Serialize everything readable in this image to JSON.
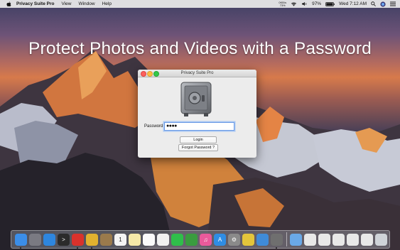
{
  "menubar": {
    "app_name": "Privacy Suite Pro",
    "menus": [
      "View",
      "Window",
      "Help"
    ],
    "status": {
      "net_up": "0KB/s",
      "net_down": "73%",
      "battery": "97%",
      "time": "Wed 7:12 AM"
    },
    "icons": [
      "apple-icon",
      "network-stats-icon",
      "wifi-icon",
      "volume-icon",
      "battery-icon",
      "search-icon",
      "siri-icon",
      "menu-list-icon"
    ]
  },
  "headline": "Protect Photos and Videos with a Password",
  "window": {
    "title": "Privacy Suite Pro",
    "password_label": "Password",
    "password_value": "●●●●",
    "login_label": "Login",
    "forgot_label": "Forgot Password ?"
  },
  "dock": {
    "apps": [
      {
        "name": "finder-icon",
        "color": "#3b8ee8",
        "glyph": ""
      },
      {
        "name": "launchpad-icon",
        "color": "#7a7a82",
        "glyph": ""
      },
      {
        "name": "safari-icon",
        "color": "#2e86de",
        "glyph": ""
      },
      {
        "name": "terminal-icon",
        "color": "#2b2b2b",
        "glyph": ">"
      },
      {
        "name": "opera-icon",
        "color": "#d9322c",
        "glyph": ""
      },
      {
        "name": "chrome-icon",
        "color": "#e0b12f",
        "glyph": ""
      },
      {
        "name": "notefile-icon",
        "color": "#9a7a4c",
        "glyph": ""
      },
      {
        "name": "calendar-icon",
        "color": "#f4f4f4",
        "glyph": "1"
      },
      {
        "name": "notes-icon",
        "color": "#f5e9a8",
        "glyph": ""
      },
      {
        "name": "reminders-icon",
        "color": "#fafafa",
        "glyph": ""
      },
      {
        "name": "photos-icon",
        "color": "#f1f1f1",
        "glyph": ""
      },
      {
        "name": "messages-icon",
        "color": "#2fbf4a",
        "glyph": ""
      },
      {
        "name": "facetime-icon",
        "color": "#3a9c3f",
        "glyph": ""
      },
      {
        "name": "itunes-icon",
        "color": "#ea5a9b",
        "glyph": "♫"
      },
      {
        "name": "app-store-icon",
        "color": "#2f8de4",
        "glyph": "A"
      },
      {
        "name": "system-preferences-icon",
        "color": "#8a8a8a",
        "glyph": "⚙"
      },
      {
        "name": "uniform-icon",
        "color": "#e3c53b",
        "glyph": ""
      },
      {
        "name": "xcode-icon",
        "color": "#3f8bd8",
        "glyph": ""
      },
      {
        "name": "privacy-suite-icon",
        "color": "#6f6f6f",
        "glyph": ""
      }
    ],
    "docs": [
      {
        "name": "downloads-folder-icon",
        "color": "#6aa9e8"
      },
      {
        "name": "mail-doc-icon",
        "color": "#e8e8e8"
      },
      {
        "name": "mail-doc-icon-2",
        "color": "#e8e8e8"
      },
      {
        "name": "mail-doc-icon-3",
        "color": "#e8e8e8"
      },
      {
        "name": "mail-doc-icon-4",
        "color": "#e8e8e8"
      },
      {
        "name": "mail-doc-icon-5",
        "color": "#e8e8e8"
      },
      {
        "name": "trash-icon",
        "color": "#cfd3d8"
      }
    ]
  }
}
